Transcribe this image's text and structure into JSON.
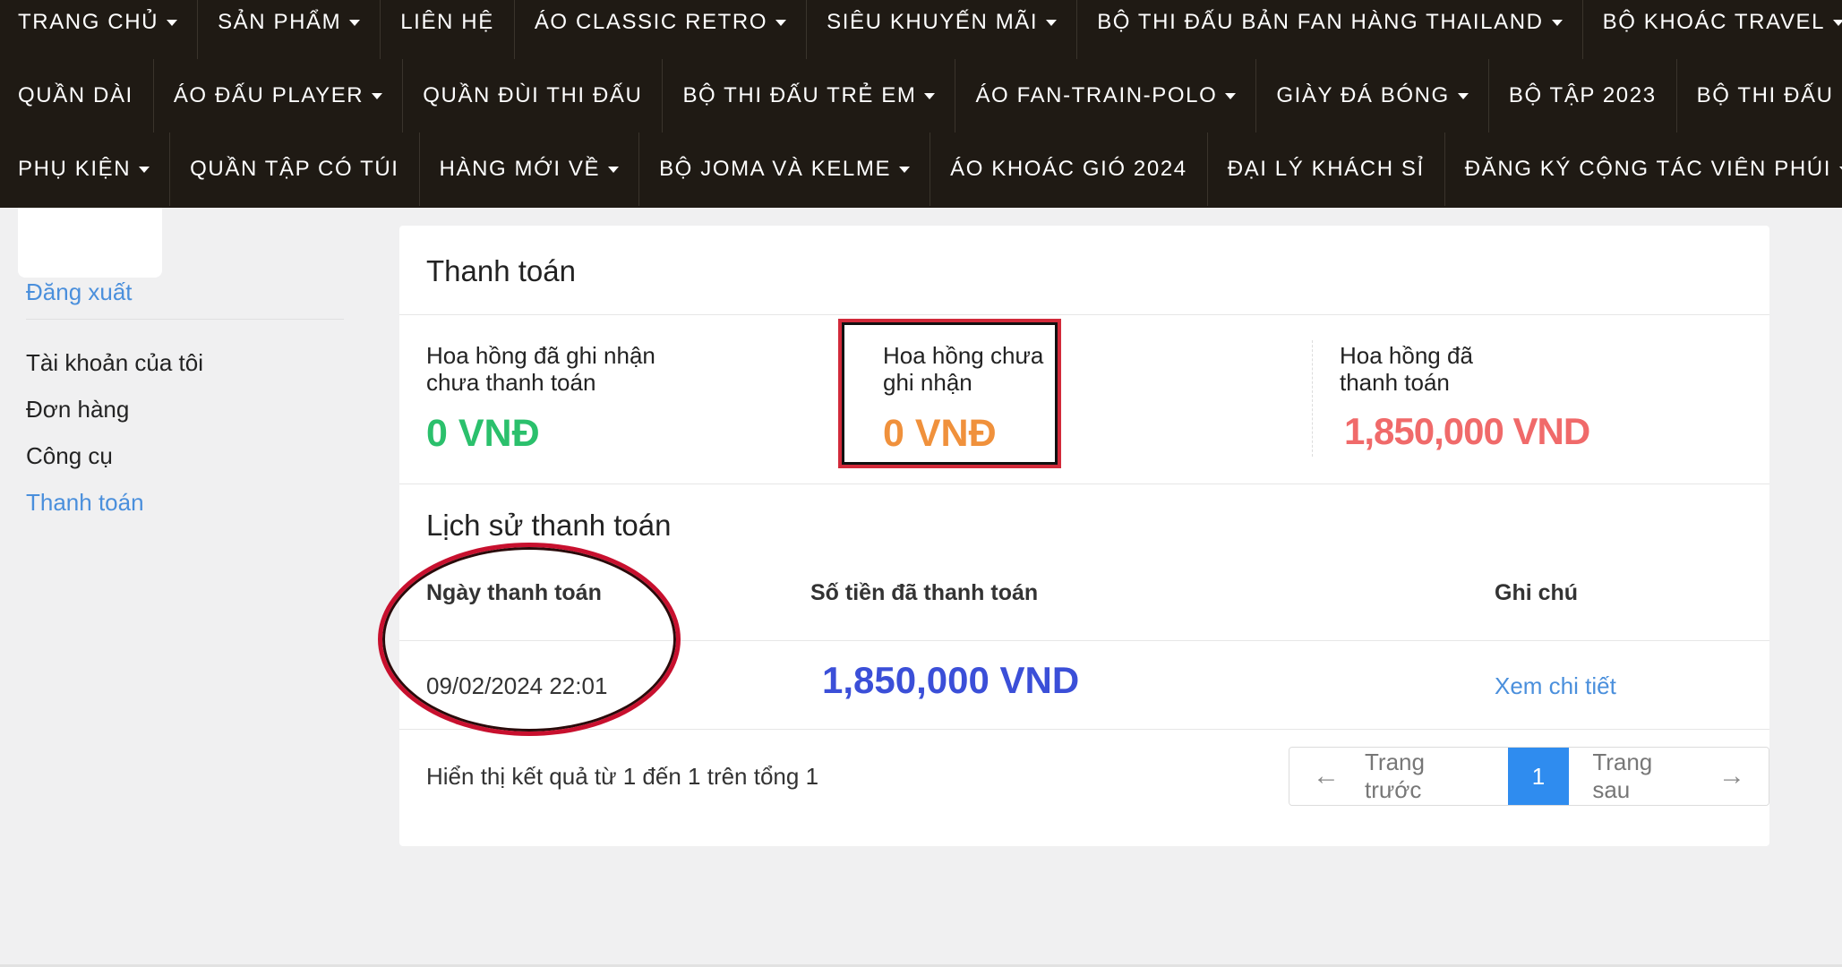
{
  "nav": {
    "row1": [
      {
        "label": "TRANG CHỦ",
        "dropdown": true
      },
      {
        "label": "SẢN PHẨM",
        "dropdown": true
      },
      {
        "label": "LIÊN HỆ",
        "dropdown": false
      },
      {
        "label": "ÁO CLASSIC RETRO",
        "dropdown": true
      },
      {
        "label": "SIÊU KHUYẾN MÃI",
        "dropdown": true
      },
      {
        "label": "BỘ THI ĐẤU BẢN FAN HÀNG THAILAND",
        "dropdown": true
      },
      {
        "label": "BỘ KHOÁC TRAVEL",
        "dropdown": true
      }
    ],
    "row2": [
      {
        "label": "QUẦN DÀI",
        "dropdown": false
      },
      {
        "label": "ÁO ĐẤU PLAYER",
        "dropdown": true
      },
      {
        "label": "QUẦN ĐÙI THI ĐẤU",
        "dropdown": false
      },
      {
        "label": "BỘ THI ĐẤU TRẺ EM",
        "dropdown": true
      },
      {
        "label": "ÁO FAN-TRAIN-POLO",
        "dropdown": true
      },
      {
        "label": "GIÀY ĐÁ BÓNG",
        "dropdown": true
      },
      {
        "label": "BỘ TẬP 2023",
        "dropdown": false
      },
      {
        "label": "BỘ THI ĐẤU PLAYER",
        "dropdown": false
      }
    ],
    "row3": [
      {
        "label": "PHỤ KIỆN",
        "dropdown": true
      },
      {
        "label": "QUẦN TẬP CÓ TÚI",
        "dropdown": false
      },
      {
        "label": "HÀNG MỚI VỀ",
        "dropdown": true
      },
      {
        "label": "BỘ JOMA VÀ KELME",
        "dropdown": true
      },
      {
        "label": "ÁO KHOÁC GIÓ 2024",
        "dropdown": false
      },
      {
        "label": "ĐẠI LÝ KHÁCH SỈ",
        "dropdown": false
      },
      {
        "label": "ĐĂNG KÝ CỘNG TÁC VIÊN PHÚI",
        "dropdown": true
      }
    ]
  },
  "sidebar": {
    "logout": "Đăng xuất",
    "items": [
      "Tài khoản của tôi",
      "Đơn hàng",
      "Công cụ",
      "Thanh toán"
    ]
  },
  "payment": {
    "title": "Thanh toán",
    "stats": {
      "recorded_unpaid": {
        "label": "Hoa hồng đã ghi nhận chưa thanh toán",
        "value": "0 VNĐ"
      },
      "unrecorded": {
        "label": "Hoa hồng chưa ghi nhận",
        "value": "0 VNĐ"
      },
      "paid": {
        "label": "Hoa hồng đã thanh toán",
        "value": "1,850,000 VND"
      }
    },
    "history_title": "Lịch sử thanh toán",
    "columns": [
      "Ngày thanh toán",
      "Số tiền đã thanh toán",
      "Ghi chú"
    ],
    "rows": [
      {
        "date": "09/02/2024 22:01",
        "amount": "1,850,000 VND",
        "note_link": "Xem chi tiết"
      }
    ],
    "summary": "Hiển thị kết quả từ 1 đến 1 trên tổng 1",
    "pagination": {
      "prev": "Trang trước",
      "current": "1",
      "next": "Trang sau"
    }
  },
  "colors": {
    "nav_bg": "#1f1a14",
    "link_blue": "#4a8fdc",
    "green": "#2bc06c",
    "orange": "#f0913c",
    "salmon": "#f06a6a",
    "amount_blue": "#3b4fd8",
    "highlight_red": "#c8102e"
  }
}
